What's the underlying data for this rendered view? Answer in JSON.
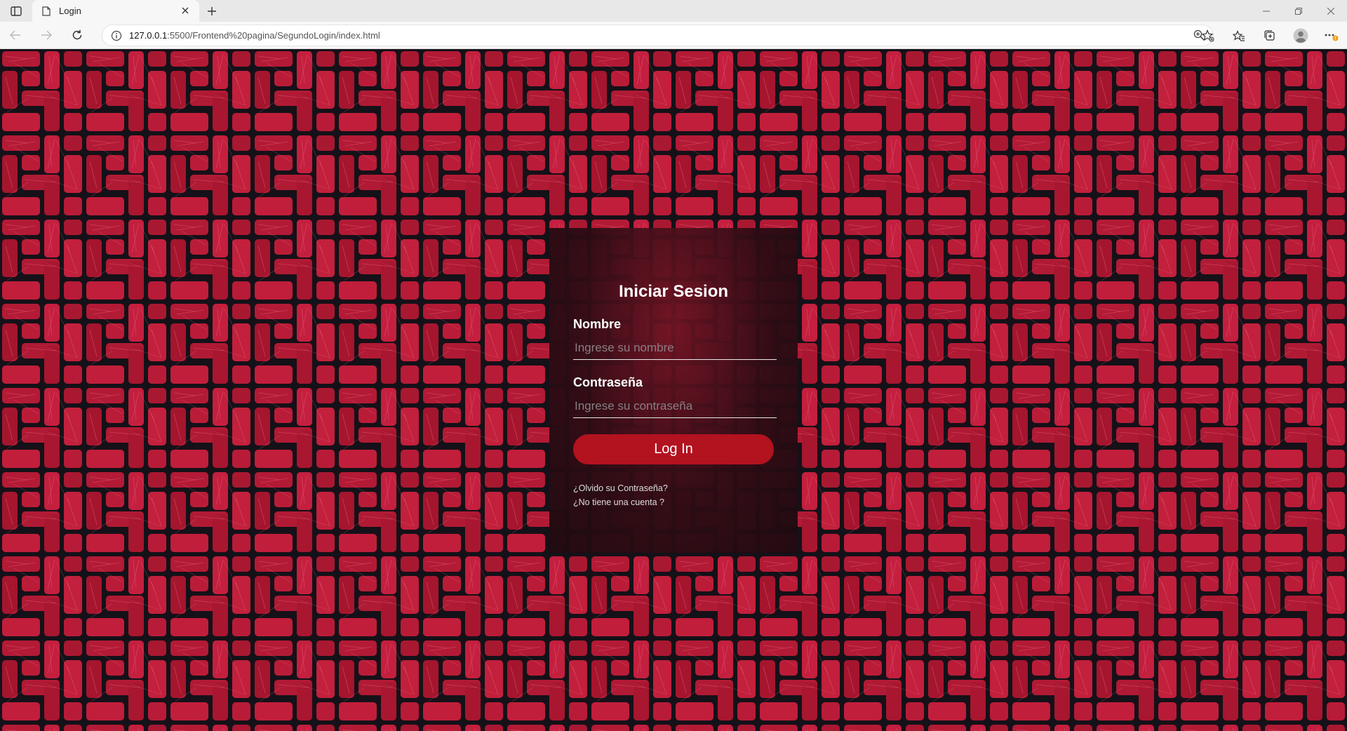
{
  "browser": {
    "tab_title": "Login",
    "url_host": "127.0.0.1",
    "url_path": ":5500/Frontend%20pagina/SegundoLogin/index.html"
  },
  "icons": {
    "sidebar": "sidebar-toggle-icon",
    "tab": "page-icon",
    "close": "close-icon",
    "new_tab": "plus-icon",
    "back": "back-arrow-icon",
    "forward": "forward-arrow-icon",
    "refresh": "refresh-icon",
    "info": "info-icon",
    "zoom": "zoom-icon",
    "favorite": "add-favorite-icon",
    "favorites": "favorites-icon",
    "collections": "collections-icon",
    "profile": "profile-icon",
    "menu": "more-menu-icon"
  },
  "login": {
    "title": "Iniciar Sesion",
    "name_label": "Nombre",
    "name_placeholder": "Ingrese su nombre",
    "password_label": "Contraseña",
    "password_placeholder": "Ingrese su contraseña",
    "submit_label": "Log In",
    "forgot_link": "¿Olvido su Contraseña?",
    "signup_link": "¿No tiene una cuenta ?"
  },
  "colors": {
    "accent": "#b3121f",
    "fabric_red": "#b31a35",
    "fabric_dark": "#151118"
  }
}
